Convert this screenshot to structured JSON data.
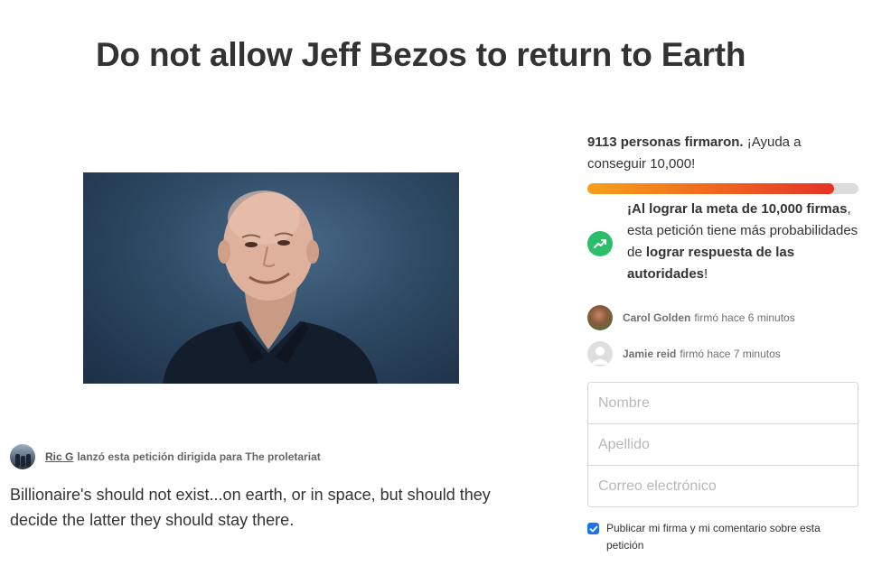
{
  "petition": {
    "title": "Do not allow Jeff Bezos to return to Earth",
    "starter": {
      "name": "Ric G",
      "text": "lanzó esta petición dirigida para The proletariat"
    },
    "description": "Billionaire's should not exist...on earth, or in space, but should they decide the latter they should stay there."
  },
  "sidebar": {
    "count_bold": "9113 personas firmaron.",
    "count_rest": " ¡Ayuda a conseguir 10,000!",
    "progress_fraction": 0.9113,
    "goal": {
      "icon": "trending-up-icon",
      "part1": "¡Al lograr la meta de 10,000 firmas",
      "part2": ", esta petición tiene más probabilidades de ",
      "part3": "lograr respuesta de las autoridades",
      "part4": "!"
    },
    "recent_signers": [
      {
        "name": "Carol Golden",
        "action": "firmó hace 6 minutos"
      },
      {
        "name": "Jamie reid",
        "action": "firmó hace 7 minutos"
      }
    ],
    "form": {
      "first_name_placeholder": "Nombre",
      "last_name_placeholder": "Apellido",
      "email_placeholder": "Correo electrónico"
    },
    "publish_checkbox_label": "Publicar mi firma y mi comentario sobre esta petición",
    "publish_checked": true
  },
  "colors": {
    "accent_green": "#2dbe6b",
    "progress_start": "#f6a019",
    "progress_end": "#e53226",
    "checkbox_blue": "#1a73e8"
  }
}
